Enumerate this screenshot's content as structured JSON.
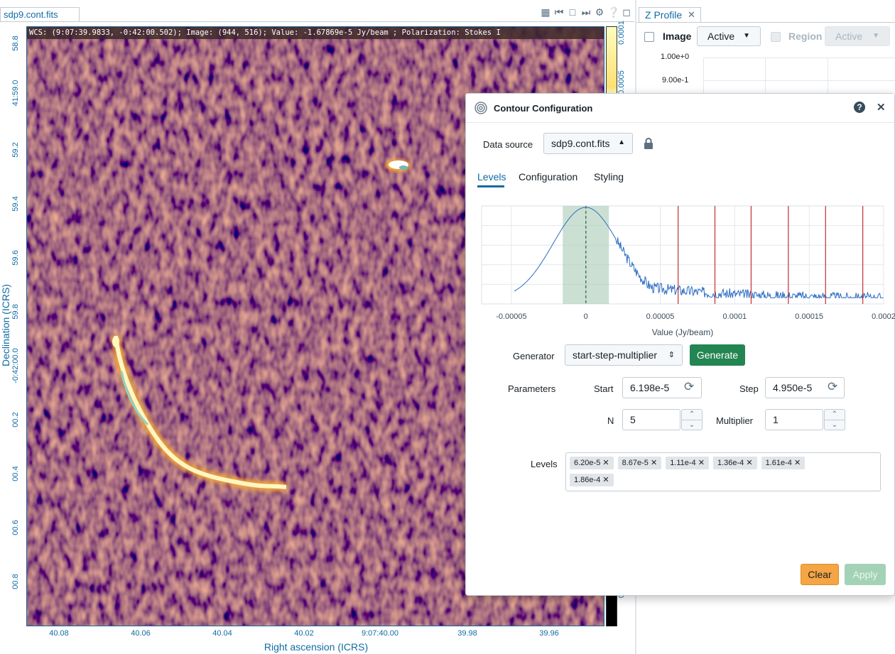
{
  "viewer": {
    "tab_label": "sdp9.cont.fits",
    "cursor_info": "WCS: (9:07:39.9833, -0:42:00.502); Image: (944, 516); Value: -1.67869e-5 Jy/beam ; Polarization: Stokes I",
    "y_axis_label": "Declination (ICRS)",
    "x_axis_label": "Right ascension (ICRS)",
    "y_ticks": [
      "58.8",
      "41:59.0",
      "59.2",
      "59.4",
      "59.6",
      "59.8",
      "-0:42:00.0",
      "00.2",
      "00.4",
      "00.6",
      "00.8"
    ],
    "x_ticks": [
      "40.08",
      "40.06",
      "40.04",
      "40.02",
      "9:07:40.00",
      "39.98",
      "39.96"
    ],
    "colorbar_ticks": [
      "0.0001",
      "0.0005",
      "0"
    ],
    "toolbar_icons": [
      "layout-icon",
      "skip-back-icon",
      "square-icon",
      "skip-forward-icon",
      "gear-icon",
      "help-icon",
      "maximize-icon"
    ]
  },
  "zprofile": {
    "tab_label": "Z Profile",
    "image_checkbox_label": "Image",
    "image_dropdown": "Active",
    "region_checkbox_label": "Region",
    "region_dropdown": "Active",
    "y_ticks": [
      "1.00e+0",
      "9.00e-1"
    ]
  },
  "dialog": {
    "title": "Contour Configuration",
    "data_source_label": "Data source",
    "data_source_value": "sdp9.cont.fits",
    "tabs": [
      "Levels",
      "Configuration",
      "Styling"
    ],
    "active_tab": "Levels",
    "generator_label": "Generator",
    "generator_value": "start-step-multiplier",
    "generate_button": "Generate",
    "parameters_label": "Parameters",
    "start_label": "Start",
    "start_value": "6.198e-5",
    "step_label": "Step",
    "step_value": "4.950e-5",
    "n_label": "N",
    "n_value": "5",
    "multiplier_label": "Multiplier",
    "multiplier_value": "1",
    "levels_label": "Levels",
    "levels": [
      "6.20e-5",
      "8.67e-5",
      "1.11e-4",
      "1.36e-4",
      "1.61e-4",
      "1.86e-4"
    ],
    "clear_button": "Clear",
    "apply_button": "Apply",
    "colors": {
      "generate": "#238551",
      "clear": "#f5a543",
      "apply": "#a3d2b6",
      "tab_active": "#106ba3"
    }
  },
  "chart_data": {
    "type": "histogram",
    "xlabel": "Value (Jy/beam)",
    "x_ticks": [
      "-0.00005",
      "0",
      "0.00005",
      "0.0001",
      "0.00015",
      "0.0002"
    ],
    "xlim": [
      -7e-05,
      0.0002
    ],
    "contour_levels": [
      6.2e-05,
      8.67e-05,
      0.000111,
      0.000136,
      0.000161,
      0.000186
    ],
    "mean": 0,
    "rms_band": [
      -1.55e-05,
      1.55e-05
    ],
    "grid": true
  }
}
